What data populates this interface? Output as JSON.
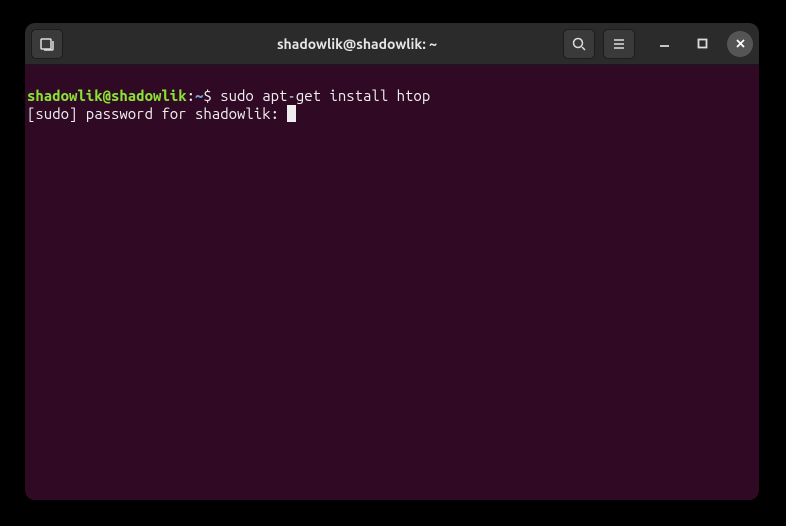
{
  "window": {
    "title": "shadowlik@shadowlik: ~"
  },
  "terminal": {
    "prompt_user_host": "shadowlik@shadowlik",
    "prompt_colon": ":",
    "prompt_path": "~",
    "prompt_symbol": "$ ",
    "command": "sudo apt-get install htop",
    "output_line": "[sudo] password for shadowlik: "
  }
}
